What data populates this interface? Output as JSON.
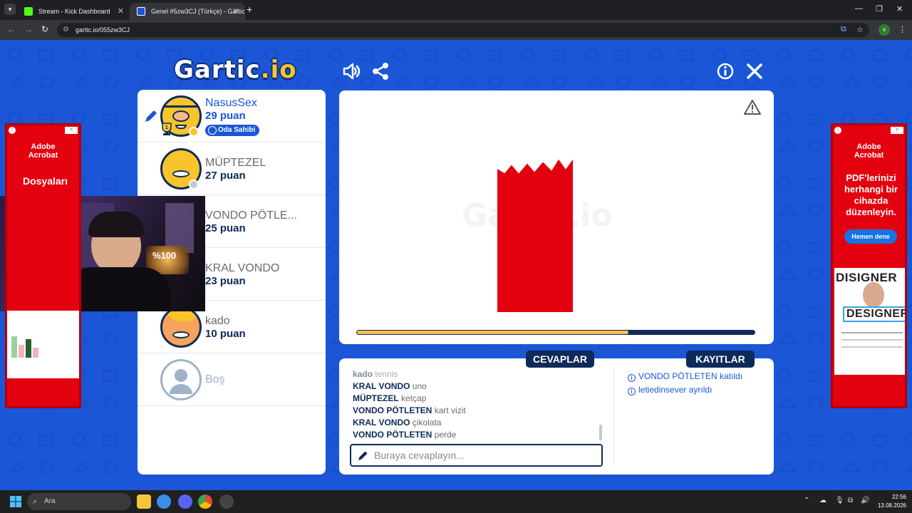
{
  "browser": {
    "tabs": [
      {
        "title": "Stream - Kick Dashboard",
        "active": false,
        "favicon_color": "#53fc18"
      },
      {
        "title": "Genel #5zw3CJ (Türkçe) - Gartic",
        "active": true,
        "favicon_color": "#1a56d6"
      }
    ],
    "url": "gartic.io/055zw3CJ",
    "profile_initial": "v"
  },
  "game": {
    "logo_main": "Gartic",
    "logo_suffix": ".io",
    "players": [
      {
        "name": "NasusSex",
        "points": "29 puan",
        "badge": "Oda Sahibi",
        "is_owner": true,
        "drawing": true,
        "avatar_color": "#f7c52b"
      },
      {
        "name": "MÜPTEZEL",
        "points": "27 puan",
        "avatar_color": "#f7c52b"
      },
      {
        "name": "VONDO PÖTLE...",
        "points": "25 puan",
        "avatar_color": "#f7c52b"
      },
      {
        "name": "KRAL VONDO",
        "points": "23 puan",
        "avatar_color": "#f7c52b"
      },
      {
        "name": "kado",
        "points": "10 puan",
        "avatar_color": "#f7a35b"
      }
    ],
    "empty_slot": "Boş",
    "timer_progress": 0.68,
    "answers_header": "CEVAPLAR",
    "logs_header": "KAYITLAR",
    "answers": [
      {
        "user": "kado",
        "text": "tennis"
      },
      {
        "user": "KRAL VONDO",
        "text": "uno"
      },
      {
        "user": "MÜPTEZEL",
        "text": "ketçap"
      },
      {
        "user": "VONDO PÖTLETEN",
        "text": "kart vizit"
      },
      {
        "user": "KRAL VONDO",
        "text": "çikolata"
      },
      {
        "user": "VONDO PÖTLETEN",
        "text": "perde"
      }
    ],
    "logs": [
      {
        "user": "VONDO PÖTLETEN",
        "text": "katıldı"
      },
      {
        "user": "letiedinsever",
        "text": "ayrıldı"
      }
    ],
    "answer_placeholder": "Buraya cevaplayın...",
    "colors": {
      "brand_blue": "#1a56d6",
      "navy": "#0e2a59",
      "timer": "#f2c14e",
      "drawing_red": "#e3000f"
    }
  },
  "ads": {
    "left": {
      "brand_line1": "Adobe",
      "brand_line2": "Acrobat",
      "text": "Dosyaları"
    },
    "right": {
      "brand_line1": "Adobe",
      "brand_line2": "Acrobat",
      "text": "PDF'lerinizi herhangi bir cihazda düzenleyin.",
      "button": "Hemen dene",
      "card_title": "DISIGNER",
      "card_title2": "DESIGNER"
    }
  },
  "webcam_overlay_text": "%100",
  "taskbar": {
    "search_placeholder": "Ara",
    "time": "22:56",
    "date": "13.08.2026"
  }
}
